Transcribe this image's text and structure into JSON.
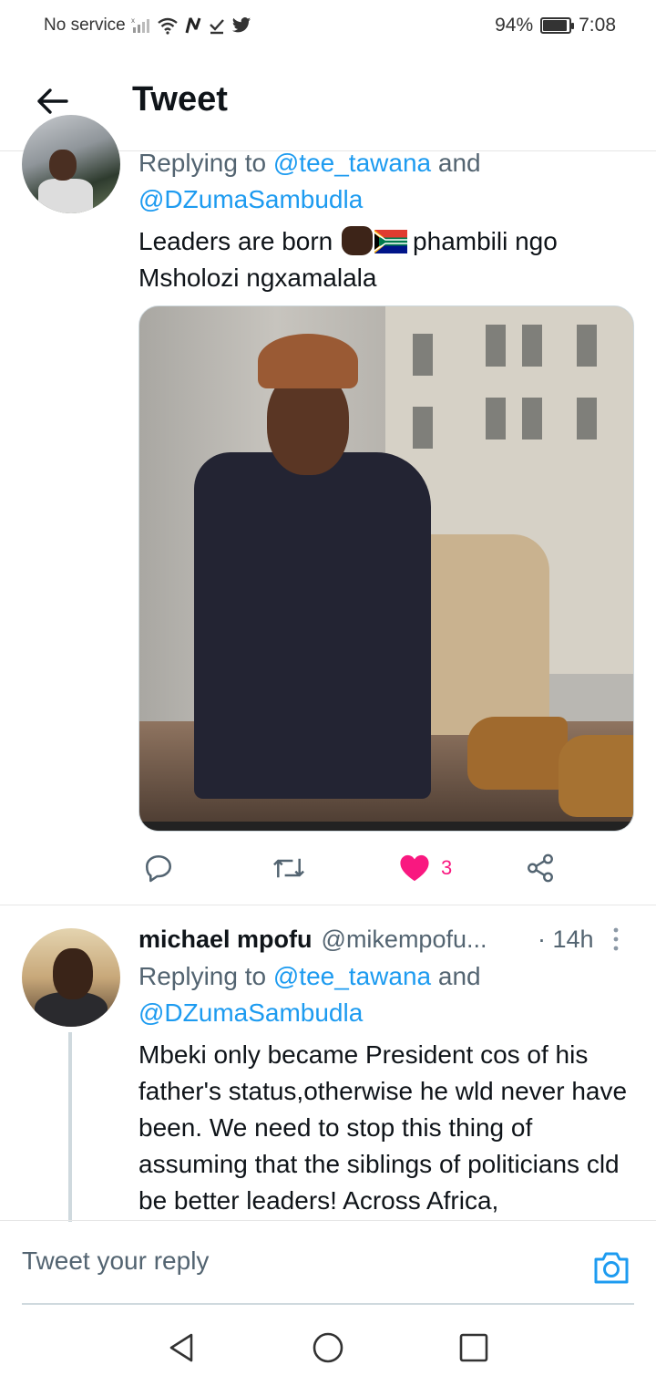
{
  "status_bar": {
    "carrier": "No service",
    "battery": "94%",
    "battery_level": 0.94,
    "time": "7:08"
  },
  "header": {
    "title": "Tweet",
    "back_icon": "arrow-left-icon"
  },
  "tweets": [
    {
      "replying_prefix": "Replying to ",
      "replying_mention1": "@tee_tawana",
      "replying_and": " and",
      "replying_mention2": "@DZumaSambudla",
      "text_part1": "Leaders are born ",
      "text_part2": "phambili ngo Msholozi ngxamalala",
      "emojis": [
        "raised-fist-dark",
        "south-africa-flag"
      ],
      "likes": "3",
      "liked": true,
      "colors": {
        "like": "#f91880",
        "link": "#1d9bf0",
        "muted": "#536471"
      }
    },
    {
      "name": "michael mpofu",
      "handle": "@mikempofu...",
      "time": "· 14h",
      "replying_prefix": "Replying to ",
      "replying_mention1": "@tee_tawana",
      "replying_and": " and",
      "replying_mention2": "@DZumaSambudla",
      "text": "Mbeki only became President cos of his father's status,otherwise he wld never have been. We need to stop this thing of assuming that the siblings of politicians cld be better leaders! Across Africa,"
    }
  ],
  "reply_bar": {
    "placeholder": "Tweet your reply",
    "camera_icon": "camera-icon"
  },
  "nav_bar": {
    "icons": [
      "nav-back-icon",
      "nav-home-icon",
      "nav-recent-icon"
    ]
  }
}
